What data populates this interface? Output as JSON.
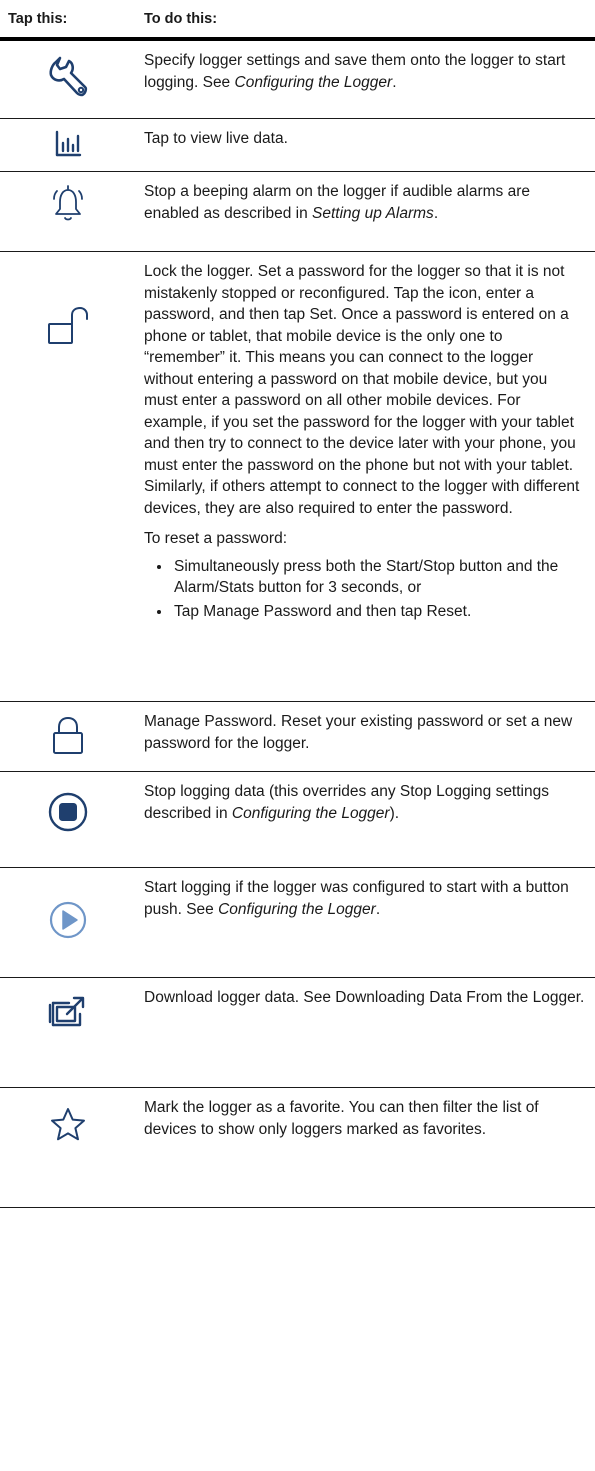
{
  "header": {
    "col1": "Tap this:",
    "col2": "To do this:"
  },
  "rows": [
    {
      "icon": "wrench-icon",
      "text_a": "Specify logger settings and save them onto the logger to start logging. See ",
      "link": "Configuring the Logger",
      "text_b": "."
    },
    {
      "icon": "bar-chart-icon",
      "text": "Tap to view live data."
    },
    {
      "icon": "bell-alarm-icon",
      "text_a": "Stop a beeping alarm on the logger if audible alarms are enabled as described in ",
      "link": "Setting up Alarms",
      "text_b": "."
    },
    {
      "icon": "unlock-icon",
      "para1": "Lock the logger. Set a password for the logger so that it is not mistakenly stopped or reconfigured. Tap the icon, enter a password, and then tap Set. Once a password is entered on a phone or tablet, that mobile device is the only one to “remember” it. This means you can connect to the logger without entering a password on that mobile device, but you must enter a password on all other mobile devices. For example, if you set the password for the logger with your tablet and then try to connect to the device later with your phone, you must enter the password on the phone but not with your tablet. Similarly, if others attempt to connect to the logger with different devices, they are also required to enter the password.",
      "para2": "To reset a password:",
      "bullets": [
        "Simultaneously press both the Start/Stop button and the Alarm/Stats button for 3 seconds, or",
        "Tap Manage Password and then tap Reset."
      ]
    },
    {
      "icon": "lock-icon",
      "text": "Manage Password. Reset your existing password or set a new password for the logger."
    },
    {
      "icon": "stop-icon",
      "text_a": "Stop logging data (this overrides any Stop Logging settings described in ",
      "link": "Configuring the Logger",
      "text_b": ")."
    },
    {
      "icon": "play-icon",
      "text_a": "Start logging if the logger was configured to start with a button push. See ",
      "link": "Configuring the Logger",
      "text_b": "."
    },
    {
      "icon": "download-icon",
      "text": "Download logger data. See Downloading Data From the Logger."
    },
    {
      "icon": "star-icon",
      "text": "Mark the logger as a favorite. You can then filter the list of devices to show only loggers marked as favorites."
    }
  ],
  "colors": {
    "icon_blue": "#1f3f6e",
    "icon_light": "#6f96c8",
    "rule": "#000000"
  }
}
